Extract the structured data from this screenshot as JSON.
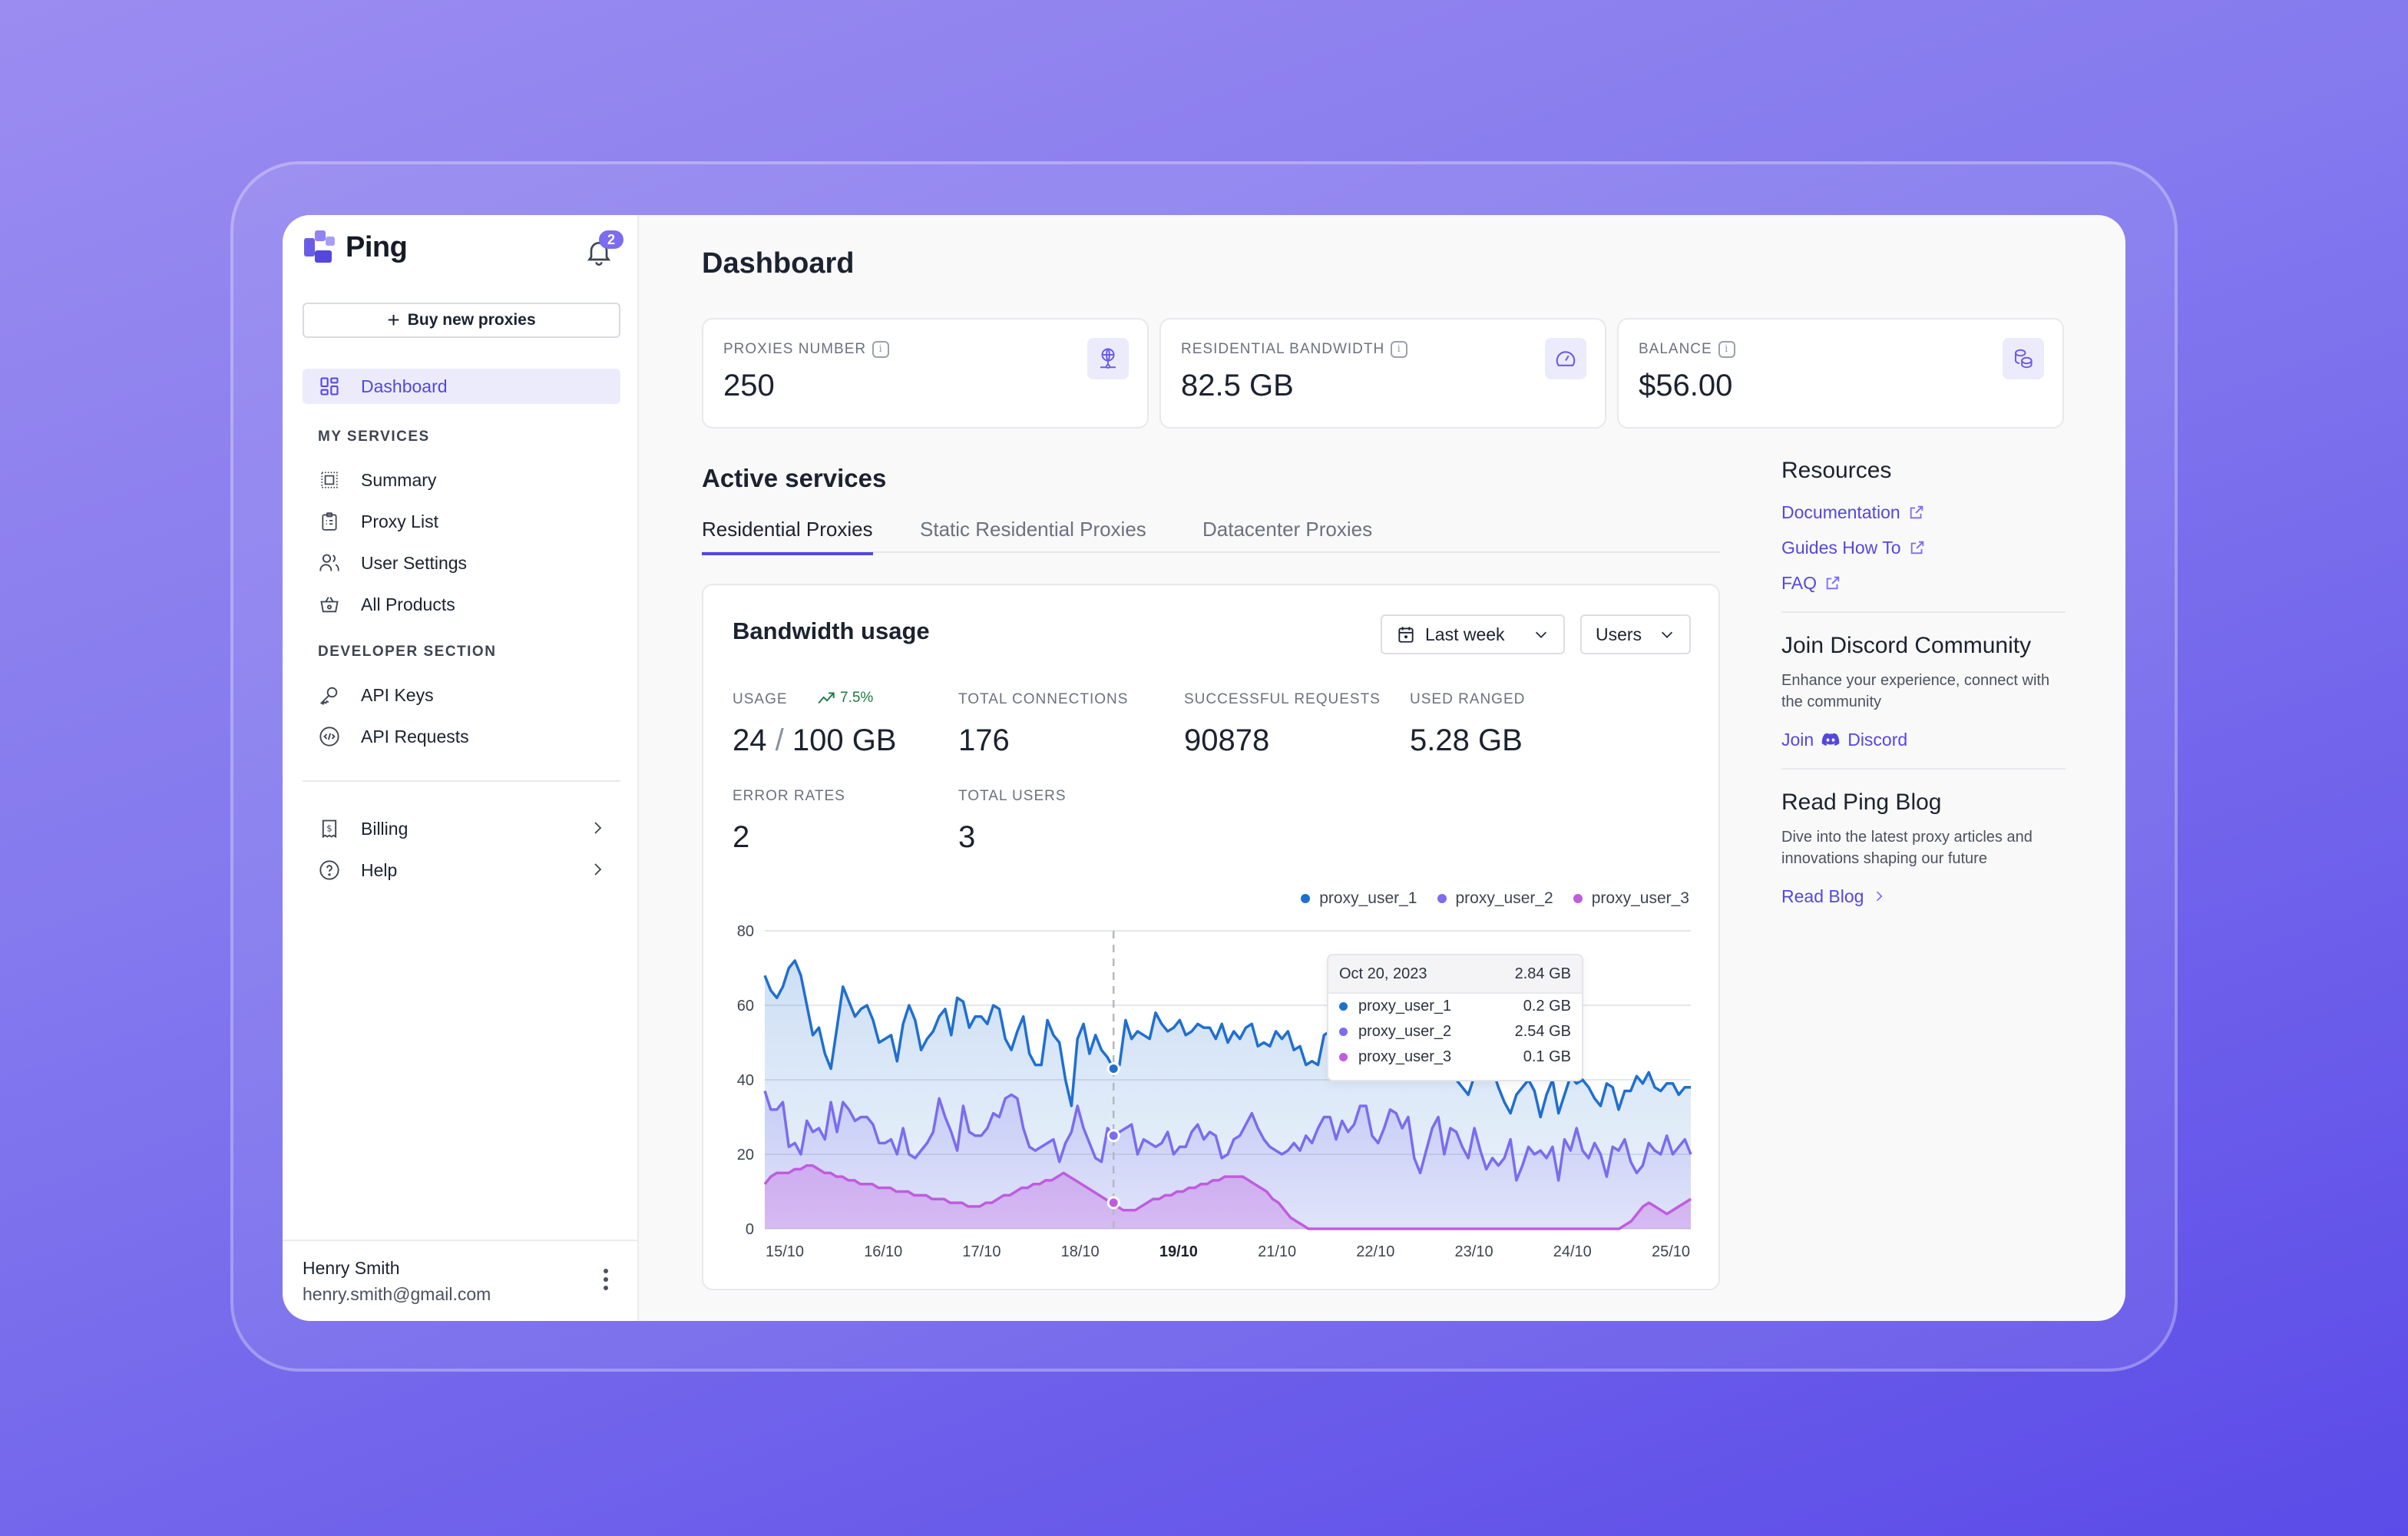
{
  "brand": {
    "name": "Ping",
    "notification_count": "2"
  },
  "sidebar": {
    "buy_button": "Buy new proxies",
    "dashboard": "Dashboard",
    "section_services": "MY SERVICES",
    "services": [
      {
        "label": "Summary",
        "icon": "summary-icon"
      },
      {
        "label": "Proxy List",
        "icon": "clipboard-list-icon"
      },
      {
        "label": "User Settings",
        "icon": "users-icon"
      },
      {
        "label": "All Products",
        "icon": "basket-icon"
      }
    ],
    "section_developer": "DEVELOPER SECTION",
    "developer": [
      {
        "label": "API Keys",
        "icon": "key-icon"
      },
      {
        "label": "API Requests",
        "icon": "code-icon"
      }
    ],
    "bottom": [
      {
        "label": "Billing",
        "icon": "receipt-icon"
      },
      {
        "label": "Help",
        "icon": "help-circle-icon"
      }
    ],
    "user": {
      "name": "Henry Smith",
      "email": "henry.smith@gmail.com"
    }
  },
  "header": {
    "title": "Dashboard"
  },
  "stats": [
    {
      "label": "PROXIES NUMBER",
      "value": "250",
      "icon": "globe-network-icon"
    },
    {
      "label": "RESIDENTIAL BANDWIDTH",
      "value": "82.5 GB",
      "icon": "gauge-icon"
    },
    {
      "label": "BALANCE",
      "value": "$56.00",
      "icon": "coins-icon"
    }
  ],
  "active_services": {
    "title": "Active services",
    "tabs": [
      {
        "label": "Residential Proxies",
        "active": true
      },
      {
        "label": "Static Residential Proxies",
        "active": false
      },
      {
        "label": "Datacenter Proxies",
        "active": false
      }
    ]
  },
  "bandwidth": {
    "title": "Bandwidth usage",
    "period_select": "Last week",
    "group_select": "Users",
    "metrics": {
      "usage_label": "USAGE",
      "usage_trend": "7.5%",
      "usage_value": "24",
      "usage_total": "100 GB",
      "connections_label": "TOTAL CONNECTIONS",
      "connections_value": "176",
      "requests_label": "SUCCESSFUL REQUESTS",
      "requests_value": "90878",
      "ranged_label": "USED RANGED",
      "ranged_value": "5.28 GB",
      "errors_label": "ERROR RATES",
      "errors_value": "2",
      "users_label": "TOTAL USERS",
      "users_value": "3"
    },
    "tooltip": {
      "date": "Oct 20, 2023",
      "total": "2.84 GB",
      "rows": [
        {
          "name": "proxy_user_1",
          "value": "0.2 GB",
          "color": "#1f6fd0"
        },
        {
          "name": "proxy_user_2",
          "value": "2.54 GB",
          "color": "#7b6cf0"
        },
        {
          "name": "proxy_user_3",
          "value": "0.1 GB",
          "color": "#c05ce0"
        }
      ]
    }
  },
  "chart_data": {
    "type": "area",
    "title": "Bandwidth usage",
    "ylim": [
      0,
      80
    ],
    "yticks": [
      "0",
      "20",
      "40",
      "60",
      "80"
    ],
    "xticks": [
      "15/10",
      "16/10",
      "17/10",
      "18/10",
      "19/10",
      "21/10",
      "22/10",
      "23/10",
      "24/10",
      "25/10"
    ],
    "highlighted_xtick": "19/10",
    "grid": true,
    "legend": "top-right",
    "hover_index": 58,
    "series": [
      {
        "name": "proxy_user_1",
        "color": "#1f6fd0",
        "values": [
          68,
          64,
          62,
          65,
          70,
          72,
          68,
          60,
          52,
          54,
          47,
          43,
          54,
          65,
          61,
          57,
          59,
          60,
          56,
          50,
          51,
          52,
          45,
          55,
          60,
          56,
          48,
          51,
          53,
          57,
          59,
          52,
          62,
          61,
          54,
          57,
          57,
          55,
          60,
          59,
          51,
          48,
          53,
          57,
          47,
          44,
          44,
          56,
          52,
          50,
          40,
          33,
          51,
          55,
          47,
          52,
          48,
          46,
          43,
          44,
          56,
          51,
          53,
          52,
          51,
          58,
          55,
          53,
          54,
          56,
          52,
          53,
          55,
          54,
          54,
          51,
          55,
          50,
          53,
          51,
          54,
          55,
          49,
          50,
          49,
          53,
          51,
          53,
          48,
          49,
          44,
          45,
          44,
          52,
          53,
          46,
          51,
          53,
          49,
          56,
          50,
          55,
          54,
          52,
          50,
          48,
          53,
          50,
          43,
          42,
          46,
          44,
          47,
          42,
          46,
          40,
          38,
          36,
          41,
          47,
          41,
          43,
          38,
          34,
          31,
          36,
          38,
          40,
          37,
          30,
          36,
          40,
          31,
          36,
          41,
          39,
          40,
          38,
          35,
          33,
          39,
          38,
          32,
          37,
          37,
          41,
          39,
          42,
          38,
          37,
          39,
          39,
          36,
          38,
          38
        ]
      },
      {
        "name": "proxy_user_2",
        "color": "#7b6cf0",
        "values": [
          37,
          32,
          32,
          34,
          22,
          23,
          20,
          29,
          26,
          27,
          24,
          34,
          26,
          34,
          32,
          29,
          30,
          30,
          28,
          23,
          23,
          24,
          20,
          27,
          20,
          19,
          21,
          23,
          26,
          35,
          30,
          26,
          21,
          33,
          26,
          25,
          25,
          27,
          31,
          30,
          35,
          36,
          35,
          27,
          22,
          21,
          22,
          23,
          24,
          18,
          23,
          26,
          33,
          27,
          23,
          19,
          18,
          27,
          25,
          26,
          27,
          28,
          20,
          24,
          23,
          22,
          23,
          26,
          20,
          22,
          22,
          26,
          28,
          24,
          26,
          25,
          19,
          20,
          24,
          25,
          28,
          31,
          27,
          24,
          22,
          21,
          20,
          21,
          23,
          21,
          25,
          23,
          27,
          30,
          30,
          24,
          29,
          26,
          28,
          33,
          33,
          25,
          23,
          27,
          32,
          31,
          27,
          30,
          19,
          15,
          21,
          27,
          30,
          20,
          27,
          26,
          22,
          19,
          27,
          21,
          16,
          19,
          17,
          19,
          24,
          13,
          17,
          22,
          20,
          21,
          19,
          22,
          13,
          24,
          21,
          27,
          21,
          19,
          23,
          20,
          14,
          22,
          21,
          24,
          18,
          15,
          17,
          23,
          21,
          20,
          25,
          20,
          22,
          24,
          20
        ]
      },
      {
        "name": "proxy_user_3",
        "color": "#c05ce0",
        "values": [
          12,
          14,
          15,
          15,
          15,
          16,
          16,
          17,
          17,
          16,
          15,
          15,
          14,
          14,
          13,
          13,
          12,
          12,
          12,
          11,
          11,
          11,
          10,
          10,
          10,
          9,
          9,
          9,
          8,
          8,
          8,
          7,
          7,
          7,
          6,
          6,
          6,
          7,
          7,
          8,
          9,
          9,
          10,
          11,
          11,
          12,
          12,
          13,
          13,
          14,
          15,
          14,
          13,
          12,
          11,
          10,
          9,
          8,
          7,
          6,
          5,
          5,
          5,
          6,
          7,
          8,
          8,
          9,
          9,
          10,
          10,
          11,
          11,
          12,
          12,
          13,
          13,
          14,
          14,
          14,
          14,
          13,
          12,
          11,
          10,
          8,
          7,
          5,
          3,
          2,
          1,
          0,
          0,
          0,
          0,
          0,
          0,
          0,
          0,
          0,
          0,
          0,
          0,
          0,
          0,
          0,
          0,
          0,
          0,
          0,
          0,
          0,
          0,
          0,
          0,
          0,
          0,
          0,
          0,
          0,
          0,
          0,
          0,
          0,
          0,
          0,
          0,
          0,
          0,
          0,
          0,
          0,
          0,
          0,
          0,
          0,
          0,
          0,
          0,
          0,
          0,
          0,
          0,
          0,
          1,
          2,
          4,
          6,
          7,
          6,
          5,
          4,
          5,
          6,
          7,
          8
        ]
      }
    ]
  },
  "resources": {
    "title": "Resources",
    "links": [
      "Documentation",
      "Guides How To",
      "FAQ"
    ],
    "discord_title": "Join Discord Community",
    "discord_desc": "Enhance your experience, connect with the community",
    "discord_join": "Join",
    "discord_label": "Discord",
    "blog_title": "Read Ping Blog",
    "blog_desc": "Dive into the latest proxy articles and innovations shaping our future",
    "blog_link": "Read Blog"
  }
}
